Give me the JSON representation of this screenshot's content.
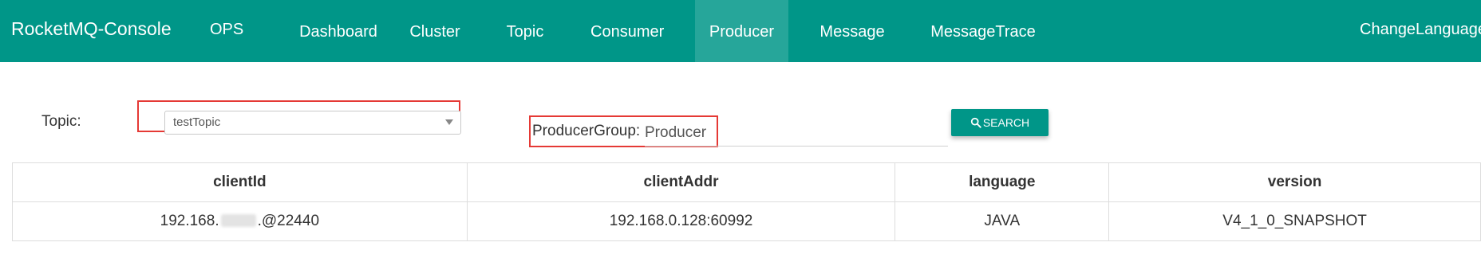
{
  "app": {
    "brand": "RocketMQ-Console"
  },
  "nav": {
    "ops": "OPS",
    "dashboard": "Dashboard",
    "cluster": "Cluster",
    "topic": "Topic",
    "consumer": "Consumer",
    "producer": "Producer",
    "message": "Message",
    "message_trace": "MessageTrace",
    "change_language": "ChangeLanguage",
    "active": "producer"
  },
  "form": {
    "topic_label": "Topic:",
    "topic_value": "testTopic",
    "producer_group_label": "ProducerGroup:",
    "producer_group_value": "Producer",
    "search_label": "SEARCH"
  },
  "table": {
    "headers": {
      "client_id": "clientId",
      "client_addr": "clientAddr",
      "language": "language",
      "version": "version"
    },
    "rows": [
      {
        "client_id_prefix": "192.168.",
        "client_id_suffix": ".@22440",
        "client_addr": "192.168.0.128:60992",
        "language": "JAVA",
        "version": "V4_1_0_SNAPSHOT"
      }
    ]
  },
  "colors": {
    "primary": "#009688",
    "nav_active": "#26a69a",
    "highlight": "#e53935"
  },
  "icons": {
    "search": "search-icon",
    "dropdown": "chevron-down-icon"
  }
}
